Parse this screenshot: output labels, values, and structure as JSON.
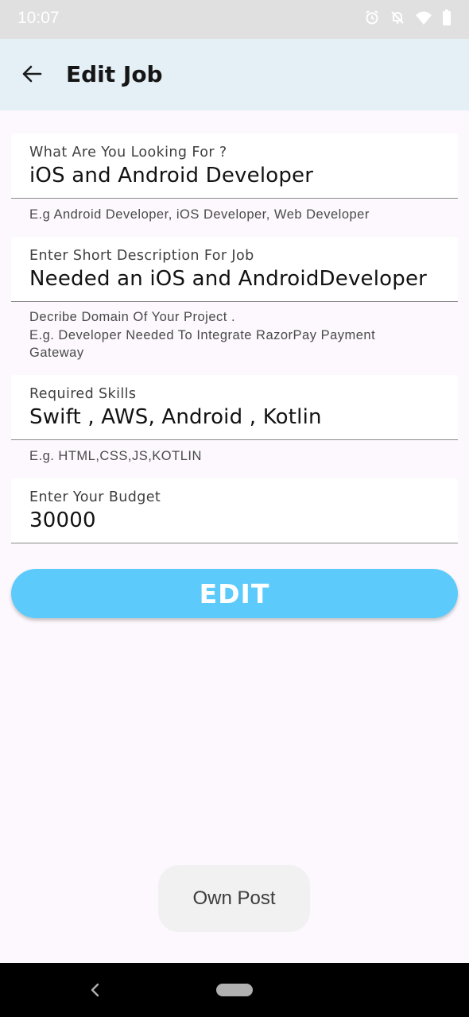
{
  "status_bar": {
    "time": "10:07",
    "icons": [
      "alarm-icon",
      "notifications-off-icon",
      "wifi-icon",
      "battery-icon"
    ]
  },
  "app_bar": {
    "back_icon": "arrow-back-icon",
    "title": "Edit Job"
  },
  "form": {
    "job_title": {
      "label": "What Are You Looking For ?",
      "value": "iOS and Android Developer",
      "helper": "E.g Android Developer, iOS Developer, Web Developer"
    },
    "description": {
      "label": "Enter Short Description For Job",
      "value": "Needed an iOS and AndroidDeveloper",
      "helper_line1": "Decribe Domain Of Your Project .",
      "helper_line2": "E.g. Developer Needed To Integrate RazorPay Payment",
      "helper_line3": "Gateway"
    },
    "skills": {
      "label": "Required Skills",
      "value": "Swift , AWS, Android , Kotlin",
      "helper": "E.g. HTML,CSS,JS,KOTLIN"
    },
    "budget": {
      "label": "Enter Your Budget",
      "value": "30000"
    }
  },
  "edit_button": {
    "label": "EDIT"
  },
  "toast": {
    "text": "Own Post"
  },
  "colors": {
    "status_bar": "#e0e0e0",
    "app_bar": "#e4eff6",
    "background": "#fcf8fd",
    "edit_button": "#5ccbfc",
    "nav_bar": "#000000"
  }
}
